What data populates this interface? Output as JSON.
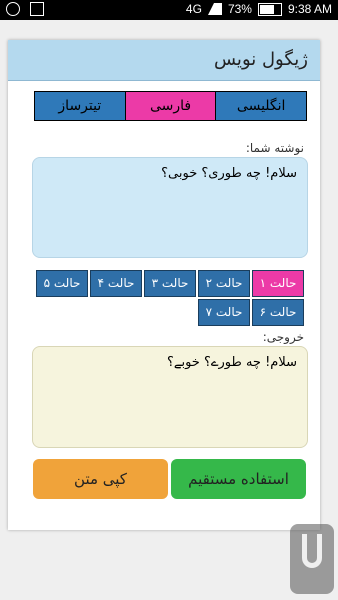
{
  "status": {
    "network": "4G",
    "battery": "73%",
    "time": "9:38 AM"
  },
  "app": {
    "title": "ژیگول نویس"
  },
  "languages": [
    {
      "label": "تیترساز",
      "active": false
    },
    {
      "label": "فارسی",
      "active": true
    },
    {
      "label": "انگلیسی",
      "active": false
    }
  ],
  "input": {
    "label": "نوشته شما:",
    "value": "سلام! چه طوری؟ خوبی؟"
  },
  "modes": [
    {
      "label": "حالت ۱",
      "active": true
    },
    {
      "label": "حالت ۲",
      "active": false
    },
    {
      "label": "حالت ۳",
      "active": false
    },
    {
      "label": "حالت ۴",
      "active": false
    },
    {
      "label": "حالت ۵",
      "active": false
    },
    {
      "label": "حالت ۶",
      "active": false
    },
    {
      "label": "حالت ۷",
      "active": false
    }
  ],
  "output": {
    "label": "خروجی:",
    "value": "سلام! چه طورے؟ خوبے؟"
  },
  "actions": {
    "direct_use": "استفاده مستقیم",
    "copy_text": "کپی متن"
  },
  "colors": {
    "accent_pink": "#ec3aa7",
    "button_blue": "#2f79b9",
    "green_button": "#35b84a",
    "orange_button": "#f0a33a"
  }
}
